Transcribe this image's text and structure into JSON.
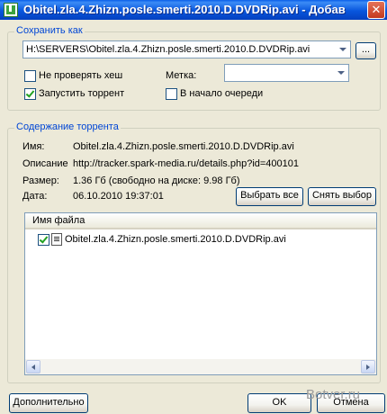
{
  "window": {
    "title": "Obitel.zla.4.Zhizn.posle.smerti.2010.D.DVDRip.avi - Добав",
    "close_glyph": "✕"
  },
  "save_as": {
    "group_title": "Сохранить как",
    "path_value": "H:\\SERVERS\\Obitel.zla.4.Zhizn.posle.smerti.2010.D.DVDRip.avi",
    "browse_label": "...",
    "skip_hash_label": "Не проверять хеш",
    "skip_hash_checked": false,
    "start_label": "Запустить торрент",
    "start_checked": true,
    "tag_label": "Метка:",
    "tag_value": "",
    "queue_top_label": "В начало очереди",
    "queue_top_checked": false
  },
  "contents": {
    "group_title": "Содержание торрента",
    "name_label": "Имя:",
    "name_value": "Obitel.zla.4.Zhizn.posle.smerti.2010.D.DVDRip.avi",
    "comment_label": "Описание",
    "comment_value": "http://tracker.spark-media.ru/details.php?id=400101",
    "size_label": "Размер:",
    "size_value": "1.36 Гб (свободно на диске: 9.98 Гб)",
    "date_label": "Дата:",
    "date_value": "06.10.2010 19:37:01",
    "select_all_label": "Выбрать все",
    "deselect_label": "Снять выбор",
    "file_column_header": "Имя файла",
    "files": [
      {
        "name": "Obitel.zla.4.Zhizn.posle.smerti.2010.D.DVDRip.avi",
        "checked": true
      }
    ]
  },
  "footer": {
    "advanced_label": "Дополнительно",
    "ok_label": "OK",
    "cancel_label": "Отмена",
    "watermark": "Botver.ru"
  }
}
